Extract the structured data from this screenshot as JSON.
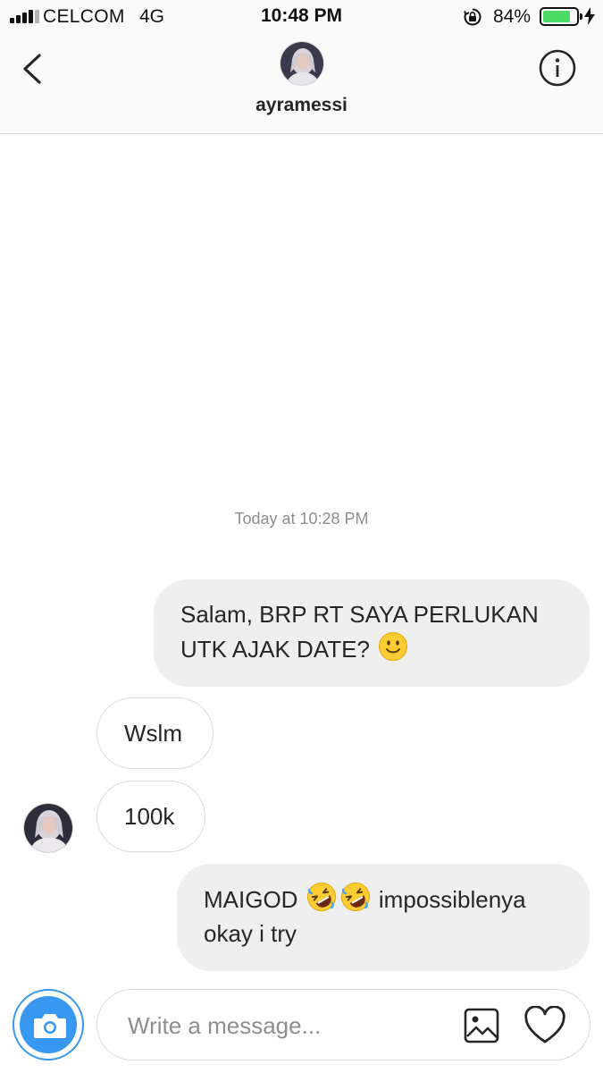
{
  "status_bar": {
    "carrier": "CELCOM",
    "network": "4G",
    "time": "10:48 PM",
    "battery_percent": "84%",
    "battery_level": 0.84,
    "icons": [
      "signal-bars-icon",
      "orientation-lock-icon",
      "battery-icon",
      "charging-bolt-icon"
    ],
    "battery_color": "#4cd964"
  },
  "header": {
    "username": "ayramessi",
    "icons": [
      "back-chevron-icon",
      "info-icon"
    ]
  },
  "thread": {
    "timestamp": "Today at 10:28 PM",
    "messages": [
      {
        "direction": "outgoing",
        "text": "Salam, BRP RT SAYA PERLUKAN UTK AJAK DATE? 🙂",
        "line1": "Salam, BRP RT SAYA PERLUKAN",
        "line2": "UTK AJAK DATE? ",
        "emoji": "🙂"
      },
      {
        "direction": "incoming",
        "text": "Wslm"
      },
      {
        "direction": "incoming",
        "text": "100k"
      },
      {
        "direction": "outgoing",
        "text": "MAIGOD 🤣🤣 impossiblenya okay i try",
        "line1_a": "MAIGOD ",
        "emojis": "🤣🤣",
        "line1_b": " impossiblenya",
        "line2": "okay i try"
      }
    ]
  },
  "composer": {
    "placeholder": "Write a message...",
    "value": "",
    "icons": [
      "camera-icon",
      "gallery-icon",
      "heart-icon"
    ],
    "accent_color": "#3897f0"
  },
  "colors": {
    "outgoing_bubble": "#efefef",
    "incoming_border": "#dbdbdb",
    "timestamp": "#8e8e8e"
  }
}
